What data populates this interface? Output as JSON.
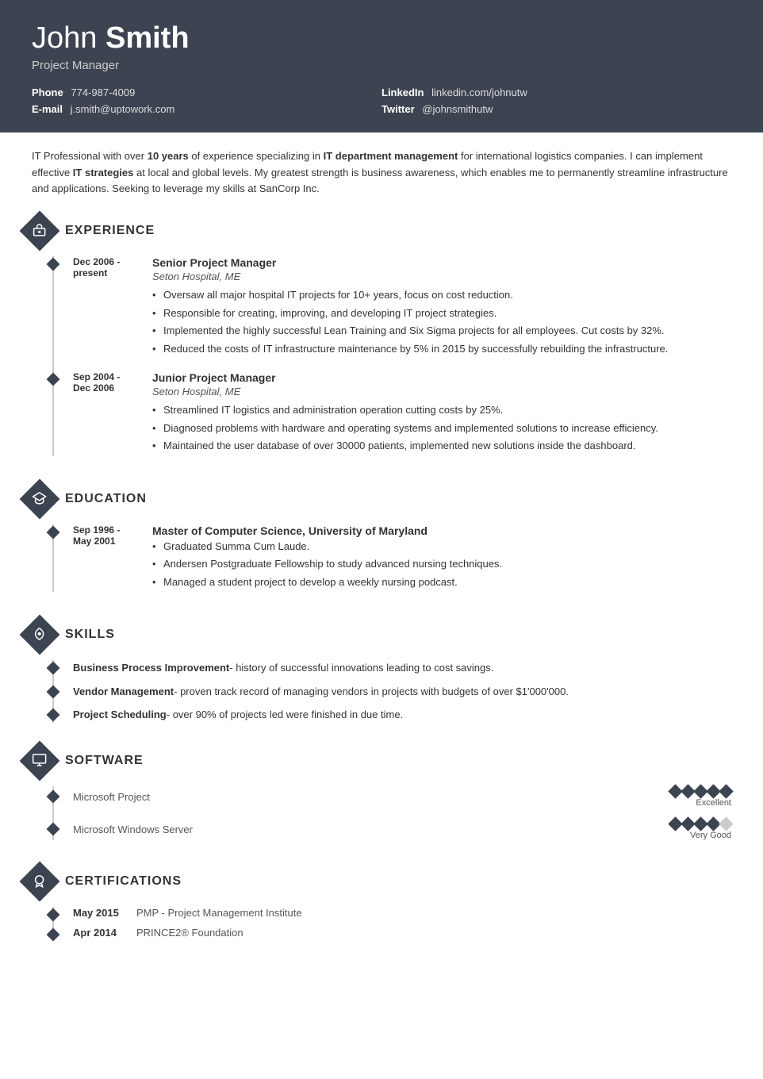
{
  "header": {
    "first_name": "John",
    "last_name": "Smith",
    "title": "Project Manager",
    "contacts": {
      "phone_label": "Phone",
      "phone_value": "774-987-4009",
      "email_label": "E-mail",
      "email_value": "j.smith@uptowork.com",
      "linkedin_label": "LinkedIn",
      "linkedin_value": "linkedin.com/johnutw",
      "twitter_label": "Twitter",
      "twitter_value": "@johnsmithutw"
    }
  },
  "summary": "IT Professional with over 10 years of experience specializing in IT department management for international logistics companies. I can implement effective IT strategies at local and global levels. My greatest strength is business awareness, which enables me to permanently streamline infrastructure and applications. Seeking to leverage my skills at SanCorp Inc.",
  "sections": {
    "experience": {
      "title": "EXPERIENCE",
      "icon": "⚙",
      "items": [
        {
          "date_start": "Dec 2006 -",
          "date_end": "present",
          "job_title": "Senior Project Manager",
          "company": "Seton Hospital, ME",
          "bullets": [
            "Oversaw all major hospital IT projects for 10+ years, focus on cost reduction.",
            "Responsible for creating, improving, and developing IT project strategies.",
            "Implemented the highly successful Lean Training and Six Sigma projects for all employees. Cut costs by 32%.",
            "Reduced the costs of IT infrastructure maintenance by 5% in 2015 by successfully rebuilding the infrastructure."
          ]
        },
        {
          "date_start": "Sep 2004 -",
          "date_end": "Dec 2006",
          "job_title": "Junior Project Manager",
          "company": "Seton Hospital, ME",
          "bullets": [
            "Streamlined IT logistics and administration operation cutting costs by 25%.",
            "Diagnosed problems with hardware and operating systems and implemented solutions to increase efficiency.",
            "Maintained the user database of over 30000 patients, implemented new solutions inside the dashboard."
          ]
        }
      ]
    },
    "education": {
      "title": "EDUCATION",
      "icon": "🎓",
      "items": [
        {
          "date_start": "Sep 1996 -",
          "date_end": "May 2001",
          "degree": "Master of Computer Science, University of Maryland",
          "bullets": [
            "Graduated Summa Cum Laude.",
            "Andersen Postgraduate Fellowship to study advanced nursing techniques.",
            "Managed a student project to develop a weekly nursing podcast."
          ]
        }
      ]
    },
    "skills": {
      "title": "SKILLS",
      "icon": "✦",
      "items": [
        {
          "name": "Business Process Improvement",
          "description": "- history of successful innovations leading to cost savings."
        },
        {
          "name": "Vendor Management",
          "description": "- proven track record of managing vendors in projects with budgets of over $1'000'000."
        },
        {
          "name": "Project Scheduling",
          "description": "- over 90% of projects led were finished in due time."
        }
      ]
    },
    "software": {
      "title": "SOFTWARE",
      "icon": "🖥",
      "items": [
        {
          "name": "Microsoft Project",
          "rating": 5,
          "max_rating": 5,
          "label": "Excellent"
        },
        {
          "name": "Microsoft Windows Server",
          "rating": 4,
          "max_rating": 5,
          "label": "Very Good"
        }
      ]
    },
    "certifications": {
      "title": "CERTIFICATIONS",
      "icon": "🏅",
      "items": [
        {
          "date": "May 2015",
          "name": "PMP - Project Management Institute"
        },
        {
          "date": "Apr 2014",
          "name": "PRINCE2® Foundation"
        }
      ]
    }
  }
}
